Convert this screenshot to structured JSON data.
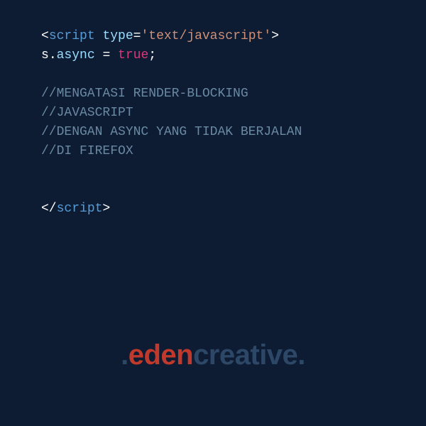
{
  "code": {
    "open_bracket": "<",
    "script_tag": "script",
    "space": " ",
    "type_attr": "type",
    "equals": "=",
    "type_val": "'text/javascript'",
    "close_bracket": ">",
    "s_ident": "s",
    "dot": ".",
    "async_prop": "async",
    "assign": " = ",
    "true_kw": "true",
    "semicolon": ";",
    "comment1": "//MENGATASI RENDER-BLOCKING",
    "comment2": "//JAVASCRIPT",
    "comment3": "//DENGAN ASYNC YANG TIDAK BERJALAN",
    "comment4": "//DI FIREFOX",
    "end_open": "</",
    "end_tag": "script",
    "end_close": ">"
  },
  "watermark": {
    "dot1": ".",
    "eden": "eden",
    "creative": "creative",
    "dot2": "."
  }
}
